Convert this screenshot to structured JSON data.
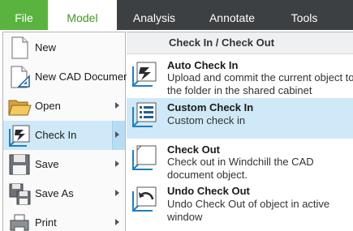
{
  "ribbon": {
    "tabs": [
      "File",
      "Model",
      "Analysis",
      "Annotate",
      "Tools"
    ],
    "active": "Model"
  },
  "left_menu": {
    "items": [
      {
        "label": "New",
        "icon": "new-document-icon",
        "has_submenu": false
      },
      {
        "label": "New CAD Document",
        "icon": "new-cad-document-icon",
        "has_submenu": false
      },
      {
        "label": "Open",
        "icon": "folder-open-icon",
        "has_submenu": true
      },
      {
        "label": "Check In",
        "icon": "check-in-icon",
        "has_submenu": true
      },
      {
        "label": "Save",
        "icon": "floppy-disk-icon",
        "has_submenu": true
      },
      {
        "label": "Save As",
        "icon": "save-as-icon",
        "has_submenu": true
      },
      {
        "label": "Print",
        "icon": "printer-icon",
        "has_submenu": true
      }
    ],
    "active": "Check In"
  },
  "submenu": {
    "header": "Check In / Check Out",
    "items": [
      {
        "title": "Auto Check In",
        "description": "Upload and commit the current object to the folder in the shared cabinet",
        "icon": "auto-check-in-icon"
      },
      {
        "title": "Custom Check In",
        "description": "Custom check in",
        "icon": "custom-check-in-icon"
      },
      {
        "title": "Check Out",
        "description": "Check out in Windchill the CAD document object.",
        "icon": "check-out-icon"
      },
      {
        "title": "Undo Check Out",
        "description": "Undo Check Out of object in active window",
        "icon": "undo-check-out-icon"
      }
    ],
    "active": "Custom Check In"
  },
  "colors": {
    "tab_bar": "#3c4043",
    "file_tab": "#5ab33f",
    "active_tab_text": "#3d9a1f",
    "hover_highlight": "#cfe9f8",
    "icon_blue": "#1f7fbf"
  }
}
